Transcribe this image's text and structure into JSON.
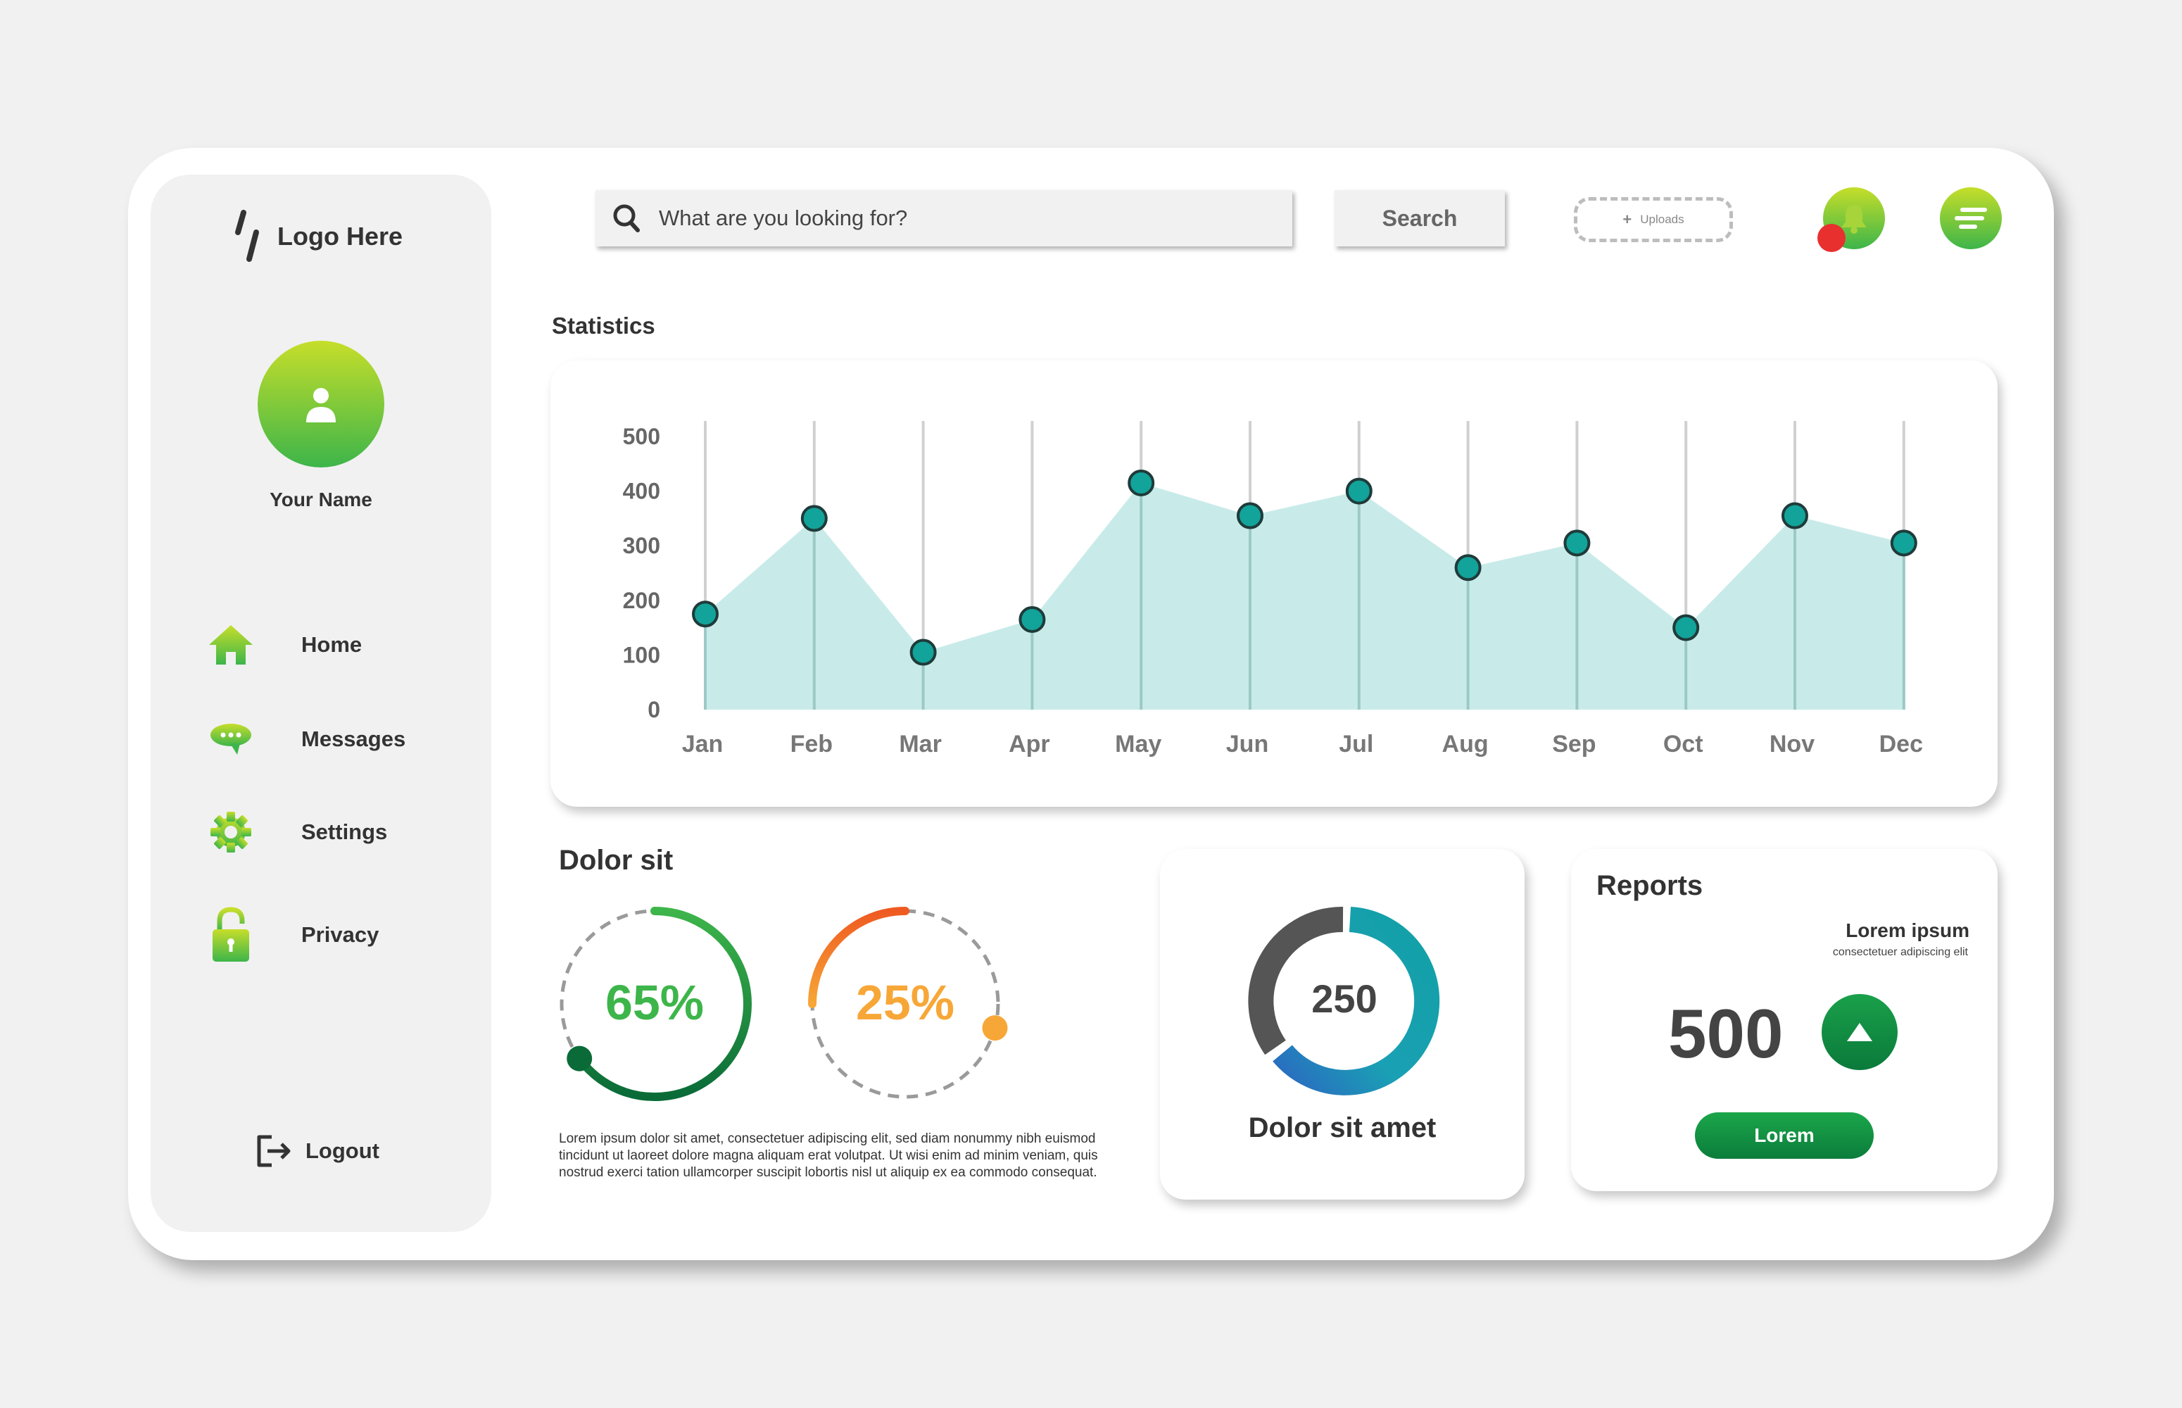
{
  "brand": {
    "logo_text": "Logo Here"
  },
  "profile": {
    "name": "Your Name"
  },
  "sidebar": {
    "items": [
      {
        "label": "Home",
        "icon": "home-icon"
      },
      {
        "label": "Messages",
        "icon": "chat-icon"
      },
      {
        "label": "Settings",
        "icon": "gear-icon"
      },
      {
        "label": "Privacy",
        "icon": "lock-icon"
      }
    ],
    "logout_label": "Logout"
  },
  "header": {
    "search_placeholder": "What are you looking for?",
    "search_button": "Search",
    "uploads_plus": "+",
    "uploads_label": "Uploads"
  },
  "statistics": {
    "title": "Statistics",
    "chart_data": {
      "type": "area",
      "categories": [
        "Jan",
        "Feb",
        "Mar",
        "Apr",
        "May",
        "Jun",
        "Jul",
        "Aug",
        "Sep",
        "Oct",
        "Nov",
        "Dec"
      ],
      "values": [
        175,
        350,
        105,
        165,
        415,
        355,
        400,
        260,
        305,
        150,
        355,
        305
      ],
      "y_ticks": [
        500,
        400,
        300,
        200,
        100,
        0
      ],
      "ylim": [
        0,
        500
      ],
      "grid": "vertical",
      "colors": {
        "fill": "#c8ebe9",
        "marker": "#12a39a",
        "marker_stroke": "#1f3b3a"
      }
    }
  },
  "dolor_sit": {
    "title": "Dolor sit",
    "rings": [
      {
        "value_label": "65%",
        "value": 65,
        "color": "#3db54a"
      },
      {
        "value_label": "25%",
        "value": 25,
        "color": "#f7a737"
      }
    ],
    "paragraph": "Lorem ipsum dolor sit amet, consectetuer adipiscing elit, sed diam nonummy nibh euismod tincidunt ut laoreet dolore magna aliquam erat volutpat. Ut wisi enim ad minim veniam, quis nostrud exerci tation ullamcorper suscipit lobortis nisl ut aliquip ex ea commodo consequat."
  },
  "donut": {
    "value": "250",
    "caption": "Dolor sit amet",
    "colors": {
      "primary": "#12a0a6",
      "secondary": "#2a6bc1",
      "rest": "#555555"
    }
  },
  "reports": {
    "title": "Reports",
    "subtitle": "Lorem ipsum",
    "subtitle_small": "consectetuer adipiscing elit",
    "value": "500",
    "button_label": "Lorem"
  }
}
